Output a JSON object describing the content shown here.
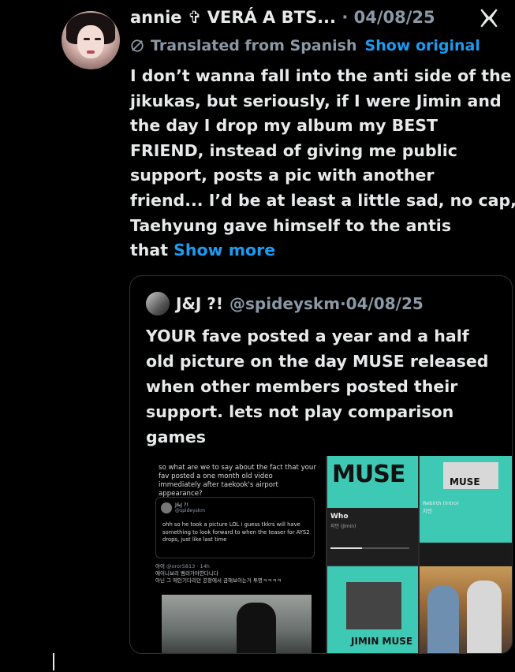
{
  "tweet": {
    "author_name": "annie ✞ VERÁ A BTS...",
    "date": "04/08/25",
    "translated_label": "Translated from Spanish",
    "show_original": "Show original",
    "text_lines": [
      "I don’t wanna fall into the anti side of the",
      "jikukas, but seriously, if I were Jimin and",
      "the day I drop my album my BEST",
      "FRIEND, instead of giving me public",
      "support, posts a pic with another",
      "friend... I’d be at least a little sad, no cap,",
      "Taehyung gave himself to the antis",
      "that"
    ],
    "show_more": "Show more"
  },
  "quote": {
    "author_name": "J&J ?!",
    "handle": "@spideyskm",
    "date": "04/08/25",
    "text_lines": [
      "YOUR fave posted a year and a half",
      "old picture on the day MUSE released",
      "when other members posted their",
      "support. lets not play comparison",
      "games"
    ]
  },
  "media": {
    "left_caption": "so what are we to say about the fact that your fav posted a one month old video immediately after taekook's airport appearance?",
    "inner_name": "J&J ?!",
    "inner_handle": "@spideyskm",
    "inner_text": "ohh so he took a picture LOL i guess tkkrs will have something to look forward to when the teaser for AYS2 drops, just like last time",
    "inner2_name": "아이",
    "inner2_handle": "@oror5813 · 14h",
    "inner2_line1": "에이니보리 뱀리가야한다니다",
    "inner2_line2": "아닌 그 에인기다리던 공항에서 금해보이는거 투명ㅋㅋㅋㅋ",
    "muse_label": "MUSE",
    "who_title": "Who",
    "who_sub": "지민 (Jimin)",
    "rebirth_label": "Rebirth (Intro)",
    "rebirth_sub": "지민",
    "jimin_muse": "JIMIN MUSE"
  },
  "icons": {
    "platform": "x-logo-icon",
    "translate": "globe-slash-icon"
  },
  "colors": {
    "background": "#000000",
    "text": "#e7e9ea",
    "muted": "#8b98a5",
    "link": "#1d9bf0",
    "border": "#2f3336",
    "teal": "#3ec9b4"
  }
}
